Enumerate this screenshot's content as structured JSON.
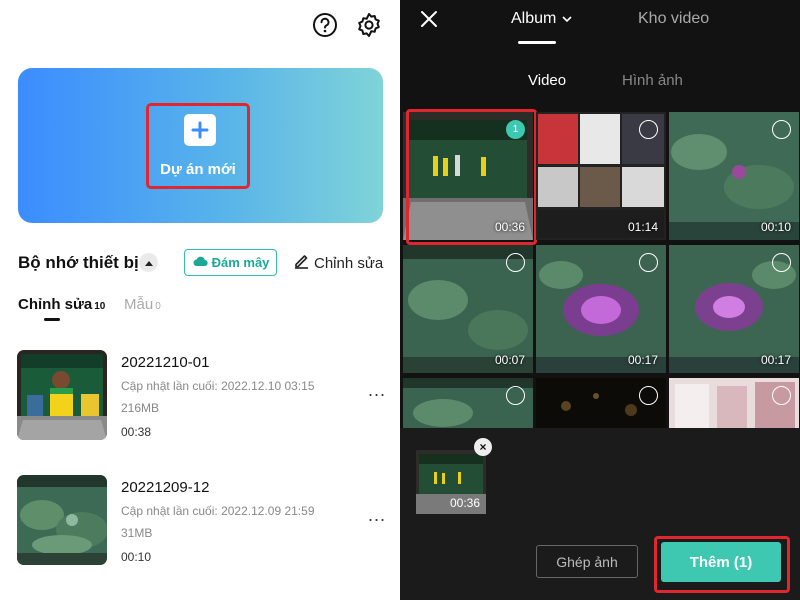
{
  "left": {
    "new_project_label": "Dự án mới",
    "storage_title": "Bộ nhớ thiết bị",
    "cloud_button_label": "Đám mây",
    "edit_label": "Chỉnh sửa",
    "tabs": [
      {
        "label": "Chỉnh sửa",
        "count": "10"
      },
      {
        "label": "Mẫu",
        "count": "0"
      }
    ],
    "projects": [
      {
        "name": "20221210-01",
        "updated": "Cập nhật lần cuối: 2022.12.10 03:15",
        "size": "216MB",
        "duration": "00:38"
      },
      {
        "name": "20221209-12",
        "updated": "Cập nhật lần cuối: 2022.12.09 21:59",
        "size": "31MB",
        "duration": "00:10"
      }
    ],
    "more_label": "..."
  },
  "right": {
    "top_tabs": {
      "album": "Album",
      "video_library": "Kho video"
    },
    "media_tabs": {
      "video": "Video",
      "image": "Hình ảnh"
    },
    "grid": [
      {
        "duration": "00:36",
        "selected": "1"
      },
      {
        "duration": "01:14"
      },
      {
        "duration": "00:10"
      },
      {
        "duration": "00:07"
      },
      {
        "duration": "00:17"
      },
      {
        "duration": "00:17"
      },
      {
        "duration": ""
      },
      {
        "duration": ""
      },
      {
        "duration": ""
      }
    ],
    "tray": {
      "duration": "00:36",
      "remove": "×"
    },
    "collage_button": "Ghép ảnh",
    "add_button": "Thêm (1)"
  },
  "colors": {
    "accent": "#3ec7b1",
    "highlight": "#e0262e",
    "gradient_start": "#3b8cff",
    "gradient_end": "#7fd3d8"
  }
}
